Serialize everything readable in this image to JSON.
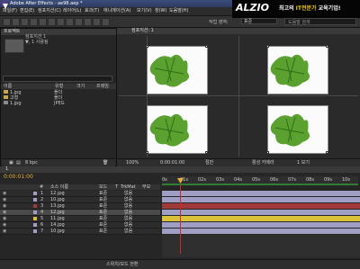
{
  "window": {
    "title": "Adobe After Effects - ae98.aep *",
    "controls": [
      "minimize-icon",
      "maximize-icon",
      "close-icon"
    ]
  },
  "menu": {
    "items": [
      "파일(F)",
      "편집(E)",
      "컴포지션(C)",
      "레이어(L)",
      "효과(T)",
      "애니메이션(A)",
      "보기(V)",
      "창(W)",
      "도움말(H)"
    ]
  },
  "ad": {
    "logo": "ALZIO",
    "slogan_pre": "최고의 ",
    "slogan_hl": "IT전문가",
    "slogan_post": " 교육기업!"
  },
  "toolbar": {
    "workspace_label": "작업 영역:",
    "workspace_value": "표준",
    "search_placeholder": "도움말 검색"
  },
  "project": {
    "tab": "프로젝트",
    "item_name": "컴포지션 1",
    "item_info": "▼, 1 사용됨",
    "search_placeholder": "",
    "columns": [
      "이름",
      "유형",
      "크기",
      "프레임"
    ],
    "rows": [
      {
        "name": "1.jpg",
        "type": "폴더",
        "size": "",
        "fps": ""
      },
      {
        "name": "고형",
        "type": "폴더",
        "size": "",
        "fps": ""
      },
      {
        "name": "1.jpg",
        "type": "JPEG",
        "size": "",
        "fps": ""
      }
    ],
    "bpc": "8 bpc"
  },
  "viewer": {
    "tab": "컴포지션: 1",
    "zoom": "100%",
    "timecode": "0:00:01:00",
    "quality": "절반",
    "camera": "활성 카메라",
    "views": "1 보기"
  },
  "timeline": {
    "tab": "1",
    "timecode": "0:00:01:00",
    "columns": [
      "#",
      "소스 이름",
      "모드",
      "T",
      "TrkMat",
      "부모"
    ],
    "ruler_ticks": [
      "0s",
      "01s",
      "02s",
      "03s",
      "04s",
      "05s",
      "06s",
      "07s",
      "08s",
      "09s",
      "10s"
    ],
    "footer": "스위치/모드 전환",
    "layers": [
      {
        "num": "1",
        "name": "12.jpg",
        "mode": "표준",
        "trk": "없음",
        "parent": "없음",
        "color": "#9f9fc6"
      },
      {
        "num": "2",
        "name": "10.jpg",
        "mode": "표준",
        "trk": "없음",
        "parent": "없음",
        "color": "#9f9fc6"
      },
      {
        "num": "3",
        "name": "13.jpg",
        "mode": "표준",
        "trk": "없음",
        "parent": "없음",
        "color": "#a03a3a"
      },
      {
        "num": "4",
        "name": "12.jpg",
        "mode": "표준",
        "trk": "없음",
        "parent": "없음",
        "color": "#9f9fc6"
      },
      {
        "num": "5",
        "name": "11.jpg",
        "mode": "표준",
        "trk": "없음",
        "parent": "없음",
        "color": "#d9c23a"
      },
      {
        "num": "6",
        "name": "14.jpg",
        "mode": "표준",
        "trk": "없음",
        "parent": "없음",
        "color": "#9f9fc6"
      },
      {
        "num": "7",
        "name": "10.jpg",
        "mode": "표준",
        "trk": "없음",
        "parent": "없음",
        "color": "#9f9fc6"
      }
    ],
    "colors": {
      "label_red": "#d4262a",
      "label_yellow": "#d9c23a",
      "lavender": "#9f9fc6",
      "work_area": "#2e7d32"
    }
  }
}
